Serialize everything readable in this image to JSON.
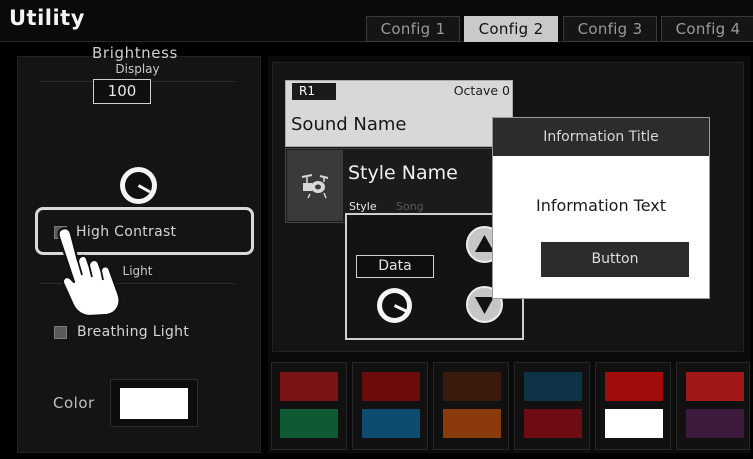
{
  "app": {
    "title": "Utility"
  },
  "tabs": [
    {
      "label": "Config 1",
      "active": false
    },
    {
      "label": "Config 2",
      "active": true
    },
    {
      "label": "Config 3",
      "active": false
    },
    {
      "label": "Config 4",
      "active": false
    }
  ],
  "left_panel": {
    "display_header": "Display",
    "brightness_label": "Brightness",
    "brightness_value": "100",
    "high_contrast_label": "High Contrast",
    "light_header": "Light",
    "breathing_light_label": "Breathing Light",
    "color_label": "Color",
    "color_value": "#ffffff"
  },
  "sound_card": {
    "tag": "R1",
    "octave": "Octave 0",
    "name": "Sound Name"
  },
  "style_card": {
    "name": "Style Name",
    "tab_style": "Style",
    "tab_song": "Song",
    "icon": "drum-kit-icon"
  },
  "data_popup": {
    "label": "Data",
    "up_icon": "arrow-up-icon",
    "down_icon": "arrow-down-icon"
  },
  "info_dialog": {
    "title": "Information Title",
    "text": "Information Text",
    "button_label": "Button"
  },
  "color_swatches": [
    {
      "top": "#7a1414",
      "bottom": "#0d5a33"
    },
    {
      "top": "#6c0c0c",
      "bottom": "#0d4c6e"
    },
    {
      "top": "#3a1a0c",
      "bottom": "#8a3a0c"
    },
    {
      "top": "#0f3346",
      "bottom": "#6e0c14"
    },
    {
      "top": "#a30c0c",
      "bottom": "#ffffff"
    },
    {
      "top": "#a21818",
      "bottom": "#3e1a3c"
    }
  ]
}
